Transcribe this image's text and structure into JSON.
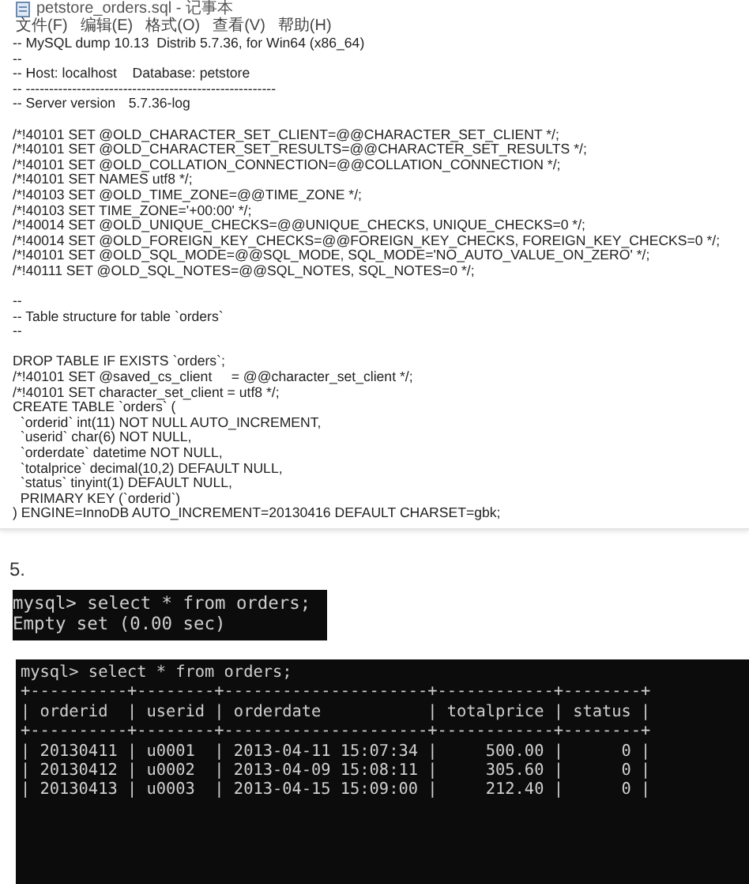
{
  "notepad": {
    "title": "petstore_orders.sql - 记事本",
    "menu": [
      {
        "label": "文件(F)"
      },
      {
        "label": "编辑(E)"
      },
      {
        "label": "格式(O)"
      },
      {
        "label": "查看(V)"
      },
      {
        "label": "帮助(H)"
      }
    ],
    "paragraphs": [
      [
        "-- MySQL dump 10.13  Distrib 5.7.36, for Win64 (x86_64)",
        "--",
        "-- Host: localhost    Database: petstore",
        "-- ------------------------------------------------------",
        "-- Server version\t5.7.36-log"
      ],
      [
        "/*!40101 SET @OLD_CHARACTER_SET_CLIENT=@@CHARACTER_SET_CLIENT */;",
        "/*!40101 SET @OLD_CHARACTER_SET_RESULTS=@@CHARACTER_SET_RESULTS */;",
        "/*!40101 SET @OLD_COLLATION_CONNECTION=@@COLLATION_CONNECTION */;",
        "/*!40101 SET NAMES utf8 */;",
        "/*!40103 SET @OLD_TIME_ZONE=@@TIME_ZONE */;",
        "/*!40103 SET TIME_ZONE='+00:00' */;",
        "/*!40014 SET @OLD_UNIQUE_CHECKS=@@UNIQUE_CHECKS, UNIQUE_CHECKS=0 */;",
        "/*!40014 SET @OLD_FOREIGN_KEY_CHECKS=@@FOREIGN_KEY_CHECKS, FOREIGN_KEY_CHECKS=0 */;",
        "/*!40101 SET @OLD_SQL_MODE=@@SQL_MODE, SQL_MODE='NO_AUTO_VALUE_ON_ZERO' */;",
        "/*!40111 SET @OLD_SQL_NOTES=@@SQL_NOTES, SQL_NOTES=0 */;"
      ],
      [
        "--",
        "-- Table structure for table `orders`",
        "--"
      ],
      [
        "DROP TABLE IF EXISTS `orders`;",
        "/*!40101 SET @saved_cs_client     = @@character_set_client */;",
        "/*!40101 SET character_set_client = utf8 */;",
        "CREATE TABLE `orders` (",
        "  `orderid` int(11) NOT NULL AUTO_INCREMENT,",
        "  `userid` char(6) NOT NULL,",
        "  `orderdate` datetime NOT NULL,",
        "  `totalprice` decimal(10,2) DEFAULT NULL,",
        "  `status` tinyint(1) DEFAULT NULL,",
        "  PRIMARY KEY (`orderid`)",
        ") ENGINE=InnoDB AUTO_INCREMENT=20130416 DEFAULT CHARSET=gbk;"
      ]
    ]
  },
  "step_label": "5.",
  "terminals": [
    {
      "kind": "short",
      "lines": [
        "mysql> select * from orders;",
        "Empty set (0.00 sec)"
      ]
    },
    {
      "kind": "wide",
      "lines": [
        "mysql> select * from orders;",
        "+----------+--------+---------------------+------------+--------+",
        "| orderid  | userid | orderdate           | totalprice | status |",
        "+----------+--------+---------------------+------------+--------+",
        "| 20130411 | u0001  | 2013-04-11 15:07:34 |     500.00 |      0 |",
        "| 20130412 | u0002  | 2013-04-09 15:08:11 |     305.60 |      0 |",
        "| 20130413 | u0003  | 2013-04-15 15:09:00 |     212.40 |      0 |"
      ]
    }
  ]
}
